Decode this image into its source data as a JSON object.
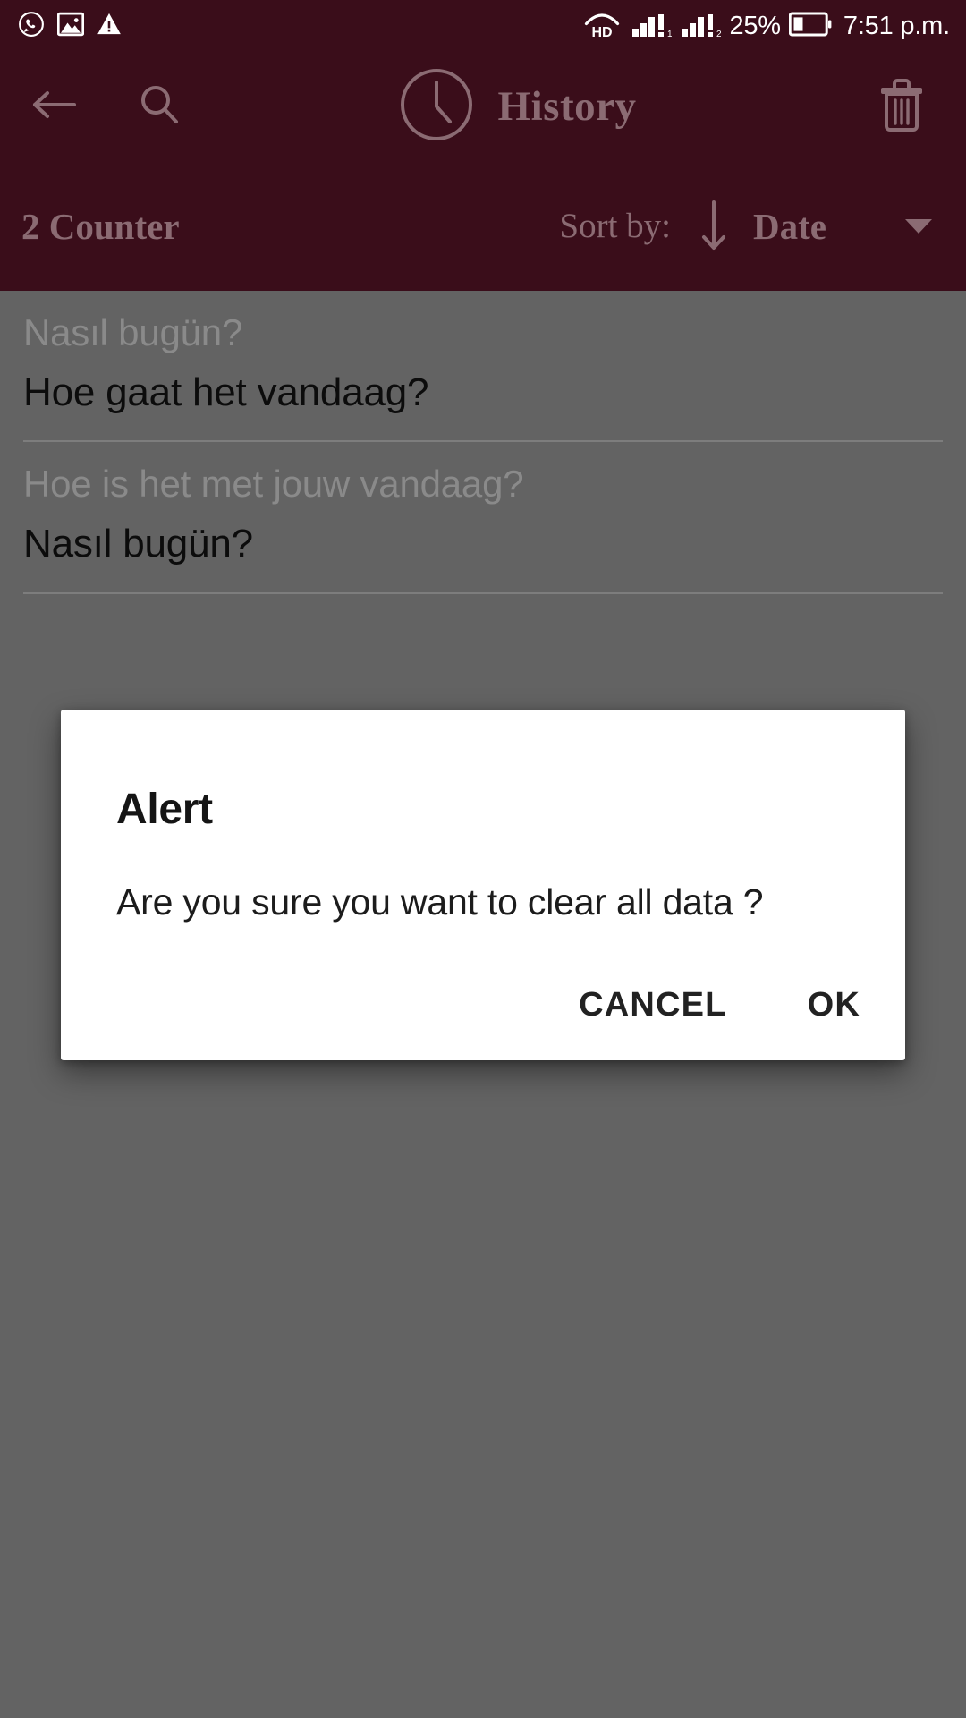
{
  "statusbar": {
    "left_icons": [
      "whatsapp-icon",
      "image-icon",
      "warning-icon"
    ],
    "hd_label": "HD",
    "signal_icons": [
      "signal-bars-sim1-icon",
      "signal-bars-sim2-icon"
    ],
    "battery_percent": "25%",
    "battery_icon": "battery-icon",
    "time": "7:51 p.m."
  },
  "toolbar": {
    "back_icon": "back-arrow-icon",
    "search_icon": "search-icon",
    "clock_icon": "clock-icon",
    "title": "History",
    "delete_icon": "trash-icon"
  },
  "sortbar": {
    "counter": "2 Counter",
    "sort_label": "Sort by:",
    "direction_icon": "arrow-down-icon",
    "sort_value": "Date",
    "caret_icon": "chevron-down-icon"
  },
  "list": {
    "items": [
      {
        "source": "Nasıl bugün?",
        "translation": "Hoe gaat het vandaag?"
      },
      {
        "source": "Hoe is het met jouw vandaag?",
        "translation": "Nasıl bugün?"
      }
    ]
  },
  "dialog": {
    "title": "Alert",
    "message": "Are you sure you want to clear all data ?",
    "cancel_label": "CANCEL",
    "ok_label": "OK"
  },
  "colors": {
    "header_bg": "#3a0d1a",
    "header_text": "#8b6b73",
    "status_text": "#ffffff",
    "content_bg": "#636363",
    "source_text": "#8a8a8a",
    "translation_text": "#0c0c0c",
    "dialog_bg": "#ffffff",
    "dialog_text": "#1c1c1c"
  }
}
